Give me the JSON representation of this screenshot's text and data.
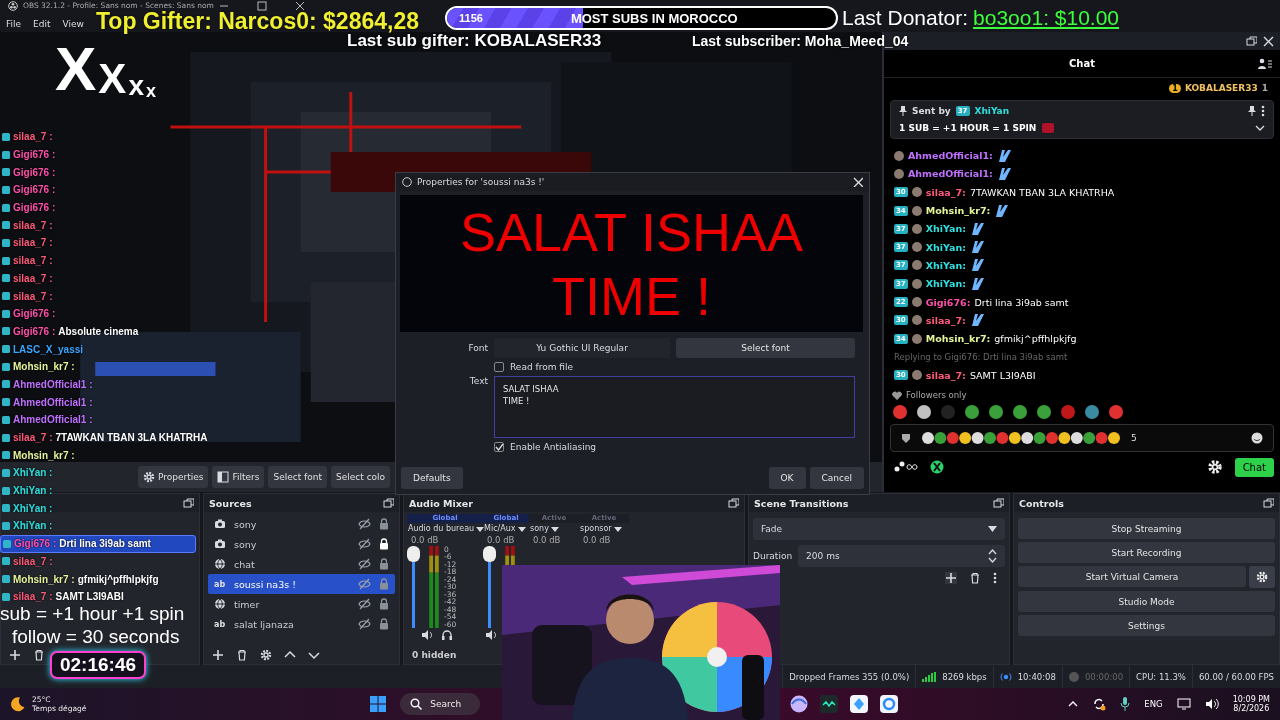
{
  "window": {
    "title": "OBS 32.1.2 - Profile: Sans nom - Scenes: Sans nom"
  },
  "menu": [
    "File",
    "Edit",
    "View"
  ],
  "overlay": {
    "top_gifter": "Top Gifter: Narcos0: $2864,28",
    "goal": {
      "count": "1156",
      "label": "MOST SUBS IN MOROCCO",
      "level": 0.35
    },
    "donator_label": "Last Donator:",
    "donator_value": "bo3oo1: $10.00",
    "sub_gifter": "Last sub gifter: KOBALASER33",
    "subscriber": "Last subscriber: Moha_Meed_04",
    "logo": [
      "X",
      "X",
      "x",
      "x"
    ],
    "promo": [
      "sub  = +1 hour +1 spin",
      "follow = 30 seconds"
    ],
    "timer": "02:16:46",
    "chat": [
      {
        "user": "silaa_7 :",
        "color": "#ff5a7a",
        "selected": false
      },
      {
        "user": "Gigi676 :",
        "color": "#ff4fa8",
        "selected": false
      },
      {
        "user": "Gigi676 :",
        "color": "#ff4fa8",
        "selected": false
      },
      {
        "user": "Gigi676 :",
        "color": "#ff4fa8",
        "selected": false
      },
      {
        "user": "Gigi676 :",
        "color": "#ff4fa8",
        "selected": false
      },
      {
        "user": "silaa_7 :",
        "color": "#ff5a7a",
        "selected": false
      },
      {
        "user": "silaa_7 :",
        "color": "#ff5a7a",
        "selected": false
      },
      {
        "user": "silaa_7 :",
        "color": "#ff5a7a",
        "selected": false
      },
      {
        "user": "silaa_7 :",
        "color": "#ff5a7a",
        "selected": false
      },
      {
        "user": "silaa_7 :",
        "color": "#ff5a7a",
        "selected": false
      },
      {
        "user": "Gigi676 :",
        "color": "#ff4fa8",
        "selected": false
      },
      {
        "user": "Gigi676 :",
        "color": "#ff4fa8",
        "text": "Absolute cinema",
        "selected": false
      },
      {
        "user": "LASC_X_yassi",
        "color": "#3da5ff",
        "selected": false
      },
      {
        "user": "Mohsin_kr7 :",
        "color": "#e6f59a",
        "selected": false
      },
      {
        "user": "AhmedOfficial1 :",
        "color": "#c070ff",
        "selected": false
      },
      {
        "user": "AhmedOfficial1 :",
        "color": "#c070ff",
        "selected": false
      },
      {
        "user": "AhmedOfficial1 :",
        "color": "#c070ff",
        "selected": false
      },
      {
        "user": "silaa_7 :",
        "color": "#ff5a7a",
        "text": "7TAWKAN TBAN 3LA KHATRHA",
        "selected": false
      },
      {
        "user": "Mohsin_kr7 :",
        "color": "#e6f59a",
        "selected": false
      },
      {
        "user": "XhiYan :",
        "color": "#2de0e0",
        "selected": false
      },
      {
        "user": "XhiYan :",
        "color": "#2de0e0",
        "selected": false
      },
      {
        "user": "XhiYan :",
        "color": "#2de0e0",
        "selected": false
      },
      {
        "user": "XhiYan :",
        "color": "#2de0e0",
        "selected": false
      },
      {
        "user": "Gigi676 :",
        "color": "#ff4fa8",
        "text": "Drti lina 3i9ab samt",
        "selected": true
      },
      {
        "user": "silaa_7 :",
        "color": "#ff5a7a",
        "selected": false
      },
      {
        "user": "Mohsin_kr7 :",
        "color": "#e6f59a",
        "text": "gfmikj^pffhlpkjfg",
        "selected": false
      },
      {
        "user": "silaa_7 :",
        "color": "#ff5a7a",
        "text": "SAMT L3I9ABI",
        "selected": false
      }
    ]
  },
  "toolbar": [
    "Properties",
    "Filters",
    "Select font",
    "Select colo"
  ],
  "chat_dock": {
    "title": "Chat",
    "leader": {
      "rank": "1",
      "name": "KOBALASER33",
      "count": "1"
    },
    "pinned": {
      "sent_by": "Sent by",
      "badge": "37",
      "user": "XhiYan",
      "text": "1 SUB = +1 HOUR = 1 SPIN"
    },
    "messages": [
      {
        "kind": "message",
        "user": "AhmedOfficial1:",
        "color": "#c070ff",
        "emote": true
      },
      {
        "kind": "message",
        "user": "AhmedOfficial1:",
        "color": "#c070ff",
        "emote": true
      },
      {
        "kind": "message",
        "badge": "30",
        "user": "silaa_7:",
        "color": "#ff5a7a",
        "text": "7TAWKAN TBAN 3LA KHATRHA",
        "emote": false
      },
      {
        "kind": "message",
        "badge": "34",
        "user": "Mohsin_kr7:",
        "color": "#e6f59a",
        "emote": true
      },
      {
        "kind": "message",
        "badge": "37",
        "user": "XhiYan:",
        "color": "#2de0e0",
        "emote": true
      },
      {
        "kind": "message",
        "badge": "37",
        "user": "XhiYan:",
        "color": "#2de0e0",
        "emote": true
      },
      {
        "kind": "message",
        "badge": "37",
        "user": "XhiYan:",
        "color": "#2de0e0",
        "emote": true
      },
      {
        "kind": "message",
        "badge": "37",
        "user": "XhiYan:",
        "color": "#2de0e0",
        "emote": true
      },
      {
        "kind": "message",
        "badge": "22",
        "user": "Gigi676:",
        "color": "#ff4fa8",
        "text": "Drti lina 3i9ab samt",
        "emote": false
      },
      {
        "kind": "message",
        "badge": "30",
        "user": "silaa_7:",
        "color": "#ff5a7a",
        "emote": true
      },
      {
        "kind": "message",
        "badge": "34",
        "user": "Mohsin_kr7:",
        "color": "#e6f59a",
        "text": "gfmikj^pffhlpkjfg",
        "emote": false
      },
      {
        "kind": "reply",
        "text": "Replying to Gigi676: Drti lina 3i9ab samt"
      },
      {
        "kind": "message",
        "badge": "30",
        "user": "silaa_7:",
        "color": "#ff5a7a",
        "text": "SAMT L3I9ABI",
        "emote": false
      }
    ],
    "mode": "Followers only",
    "input_count": "5",
    "send": "Chat"
  },
  "dialog": {
    "title": "Properties for 'soussi na3s !'",
    "preview": [
      "SALAT ISHAA",
      "TIME !"
    ],
    "font_label": "Font",
    "font_value": "Yu Gothic UI Regular",
    "select_font": "Select font",
    "read_from_file": {
      "label": "Read from file",
      "checked": false
    },
    "text_label": "Text",
    "text_value": "SALAT ISHAA\nTIME !",
    "antialias": {
      "label": "Enable Antialiasing",
      "checked": true
    },
    "buttons": {
      "defaults": "Defaults",
      "ok": "OK",
      "cancel": "Cancel"
    }
  },
  "sources": {
    "title": "Sources",
    "items": [
      {
        "kind": "camera",
        "name": "sony",
        "selected": false,
        "locked": false
      },
      {
        "kind": "camera",
        "name": "sony",
        "selected": false,
        "locked": true
      },
      {
        "kind": "browser",
        "name": "chat",
        "selected": false,
        "locked": false
      },
      {
        "kind": "text",
        "tag": "ab",
        "name": "soussi na3s !",
        "selected": true,
        "locked": false
      },
      {
        "kind": "browser",
        "name": "timer",
        "selected": false,
        "locked": false
      },
      {
        "kind": "text",
        "tag": "ab",
        "name": "salat ljanaza",
        "selected": false,
        "locked": false
      }
    ]
  },
  "mixer": {
    "title": "Audio Mixer",
    "scale": [
      "0",
      "-6",
      "-12",
      "-18",
      "-24",
      "-30",
      "-36",
      "-42",
      "-48",
      "-54",
      "-60"
    ],
    "channels": [
      {
        "kind": "global",
        "scope": "Global",
        "name": "Audio du bureau",
        "db": "0.0 dB",
        "level": 1
      },
      {
        "kind": "global",
        "scope": "Global",
        "name": "Mic/Aux",
        "db": "0.0 dB",
        "level": 1
      },
      {
        "kind": "active",
        "scope": "Active",
        "name": "sony",
        "db": "0.0 dB"
      },
      {
        "kind": "active",
        "scope": "Active",
        "name": "sponsor",
        "db": "0.0 dB"
      }
    ],
    "hidden": "0 hidden"
  },
  "transitions": {
    "title": "Scene Transitions",
    "type": "Fade",
    "duration_label": "Duration",
    "duration": "200 ms"
  },
  "controls": {
    "title": "Controls",
    "buttons": [
      "Stop Streaming",
      "Start Recording",
      "Start Virtual Camera",
      "Studio Mode",
      "Settings"
    ]
  },
  "status": {
    "dropped": "Dropped Frames 355 (0.0%)",
    "bitrate": "8269 kbps",
    "stream_time": "10:40:08",
    "rec_time": "00:00:00",
    "cpu": "CPU: 11.3%",
    "fps": "60.00 / 60.00 FPS"
  },
  "taskbar": {
    "temp": "25°C",
    "weather": "Temps dégagé",
    "search": "Search",
    "lang": "ENG",
    "time": "10:09 PM",
    "date": "8/2/2026"
  }
}
